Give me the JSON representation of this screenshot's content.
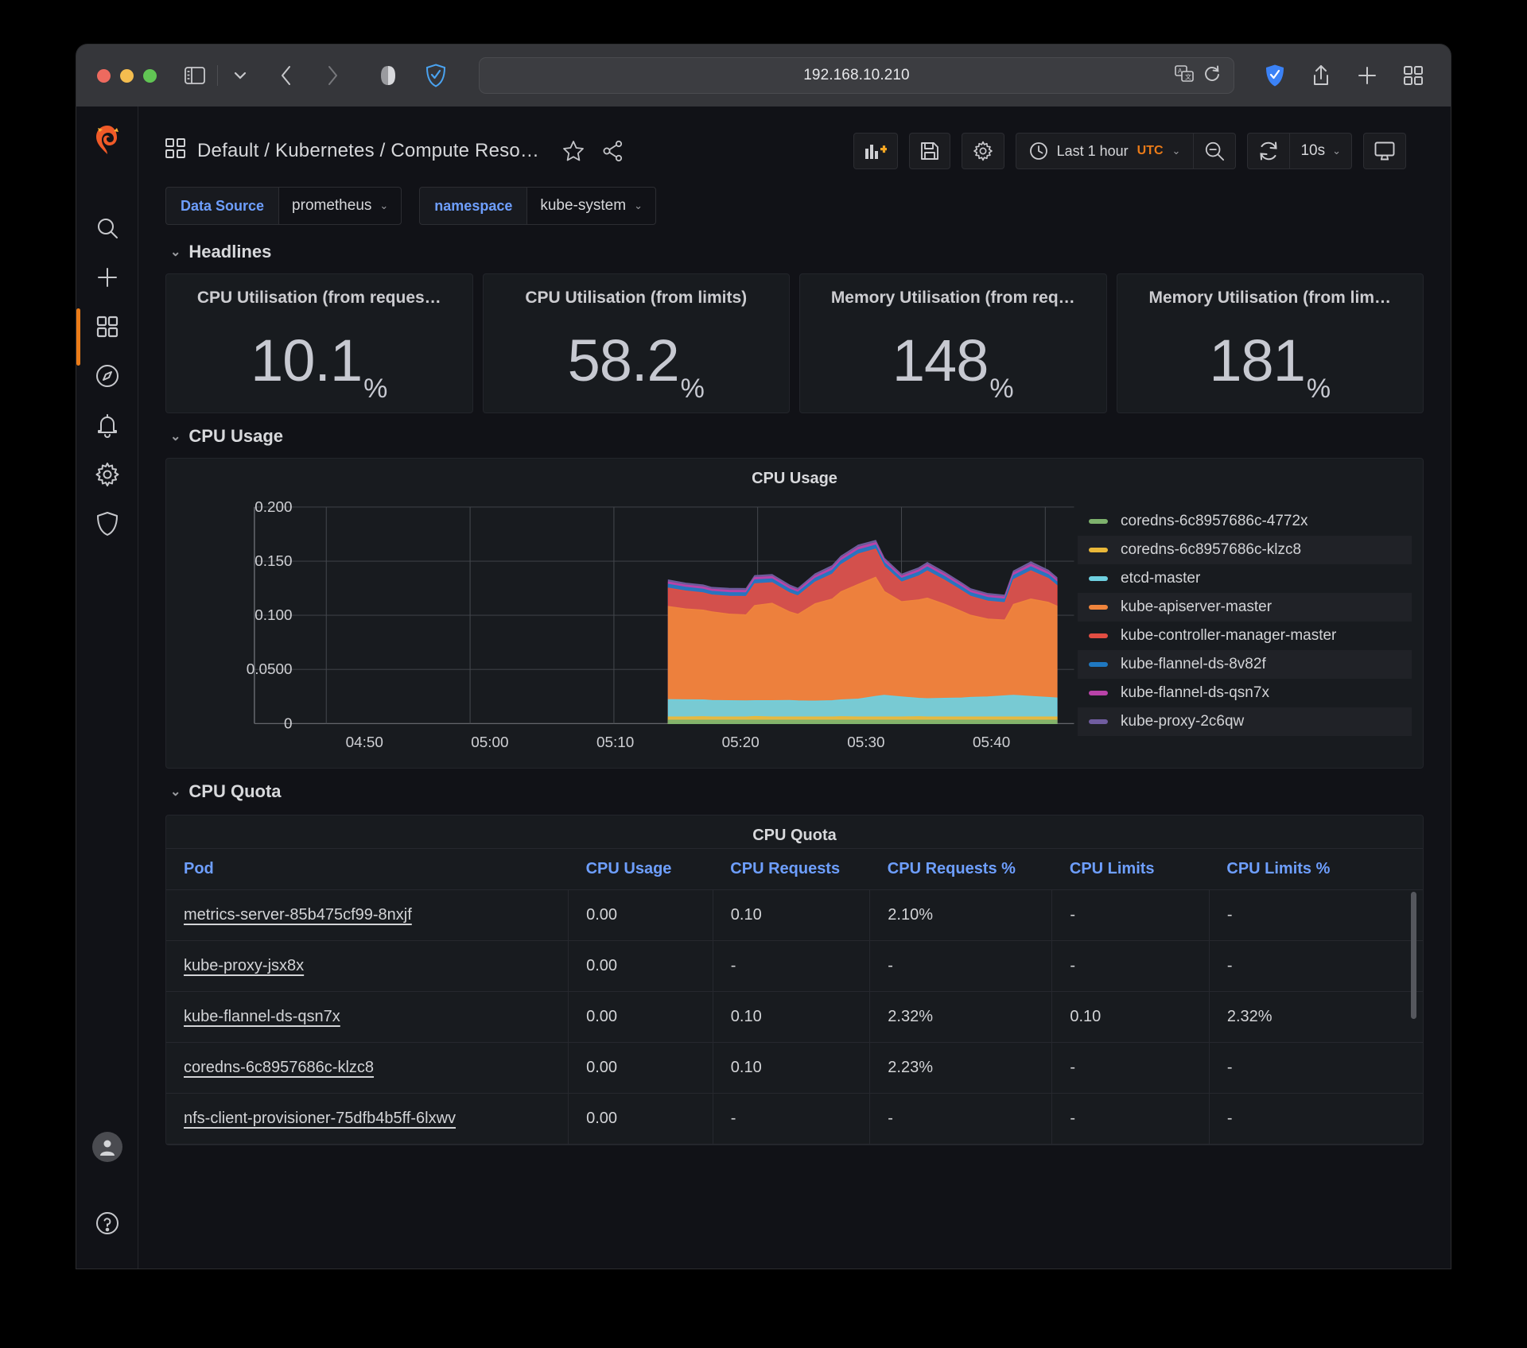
{
  "browser": {
    "url": "192.168.10.210",
    "icons": {
      "sidebar_toggle": "sidebar-toggle-icon",
      "tab_overview": "chevron-down-icon",
      "back": "back-arrow-icon",
      "forward": "forward-arrow-icon",
      "reader": "reader-view-icon",
      "shield": "privacy-shield-icon",
      "translate": "translate-icon",
      "reload": "reload-icon",
      "extension": "extension-icon",
      "share": "share-icon",
      "new_tab": "plus-icon",
      "tab_grid": "tab-overview-grid-icon"
    }
  },
  "sidebar": {
    "logo": "grafana-logo",
    "items": [
      {
        "name": "search",
        "icon": "search-icon",
        "active": false
      },
      {
        "name": "create",
        "icon": "plus-icon",
        "active": false
      },
      {
        "name": "dashboards",
        "icon": "dashboards-grid-icon",
        "active": true
      },
      {
        "name": "explore",
        "icon": "compass-icon",
        "active": false
      },
      {
        "name": "alerting",
        "icon": "bell-icon",
        "active": false
      },
      {
        "name": "configuration",
        "icon": "gear-icon",
        "active": false
      },
      {
        "name": "server-admin",
        "icon": "shield-icon",
        "active": false
      }
    ],
    "profile_icon": "user-avatar-icon",
    "help_icon": "help-circle-icon"
  },
  "header": {
    "dashboard_icon": "dashboard-grid-icon",
    "breadcrumb": "Default  /  Kubernetes  /  Compute Reso…",
    "star_icon": "star-icon",
    "share_icon": "share-nodes-icon",
    "tools": {
      "add_panel": "add-panel-icon",
      "save": "save-icon",
      "settings": "gear-icon",
      "time_range": "Last 1 hour",
      "timezone": "UTC",
      "zoom_out_icon": "zoom-out-icon",
      "refresh_icon": "refresh-icon",
      "refresh_interval": "10s",
      "tv_mode_icon": "tv-mode-icon"
    }
  },
  "variables": [
    {
      "label": "Data Source",
      "value": "prometheus"
    },
    {
      "label": "namespace",
      "value": "kube-system"
    }
  ],
  "rows": {
    "headlines": "Headlines",
    "cpu_usage": "CPU Usage",
    "cpu_quota": "CPU Quota"
  },
  "stats": [
    {
      "title": "CPU Utilisation (from reques…",
      "value": "10.1",
      "unit": "%"
    },
    {
      "title": "CPU Utilisation (from limits)",
      "value": "58.2",
      "unit": "%"
    },
    {
      "title": "Memory Utilisation (from req…",
      "value": "148",
      "unit": "%"
    },
    {
      "title": "Memory Utilisation (from lim…",
      "value": "181",
      "unit": "%"
    }
  ],
  "chart_data": {
    "type": "area",
    "title": "CPU Usage",
    "xlabel": "",
    "ylabel": "",
    "ylim": [
      0,
      0.2
    ],
    "yticks": [
      "0",
      "0.0500",
      "0.100",
      "0.150",
      "0.200"
    ],
    "ytick_values": [
      0,
      0.05,
      0.1,
      0.15,
      0.2
    ],
    "xticks": [
      "04:50",
      "05:00",
      "05:10",
      "05:20",
      "05:30",
      "05:40"
    ],
    "grid": true,
    "legend_position": "right",
    "stacked": true,
    "x": [
      5.23,
      5.25,
      5.27,
      5.28,
      5.3,
      5.32,
      5.33,
      5.35,
      5.37,
      5.38,
      5.4,
      5.42,
      5.43,
      5.45,
      5.47,
      5.48,
      5.5,
      5.52,
      5.53,
      5.55,
      5.57,
      5.58,
      5.6,
      5.62,
      5.63,
      5.65,
      5.67,
      5.68
    ],
    "series": [
      {
        "name": "coredns-6c8957686c-4772x",
        "color": "#7eb26d",
        "values": [
          0.003,
          0.003,
          0.003,
          0.003,
          0.003,
          0.003,
          0.003,
          0.003,
          0.003,
          0.003,
          0.003,
          0.003,
          0.003,
          0.003,
          0.003,
          0.003,
          0.003,
          0.003,
          0.003,
          0.003,
          0.003,
          0.003,
          0.003,
          0.003,
          0.003,
          0.003,
          0.003,
          0.003
        ]
      },
      {
        "name": "coredns-6c8957686c-klzc8",
        "color": "#eab839",
        "values": [
          0.003,
          0.003,
          0.0032,
          0.003,
          0.003,
          0.003,
          0.0034,
          0.003,
          0.003,
          0.003,
          0.003,
          0.003,
          0.0032,
          0.003,
          0.003,
          0.003,
          0.003,
          0.0032,
          0.003,
          0.003,
          0.003,
          0.003,
          0.003,
          0.003,
          0.003,
          0.003,
          0.003,
          0.003
        ]
      },
      {
        "name": "etcd-master",
        "color": "#6ed0e0",
        "values": [
          0.016,
          0.0158,
          0.0155,
          0.0152,
          0.015,
          0.0148,
          0.0146,
          0.015,
          0.0152,
          0.0148,
          0.0146,
          0.015,
          0.0155,
          0.0165,
          0.019,
          0.02,
          0.0185,
          0.017,
          0.0168,
          0.0172,
          0.0175,
          0.018,
          0.0185,
          0.0195,
          0.02,
          0.019,
          0.018,
          0.0175
        ]
      },
      {
        "name": "kube-apiserver-master",
        "color": "#ef843c",
        "values": [
          0.086,
          0.084,
          0.083,
          0.082,
          0.08,
          0.0795,
          0.088,
          0.09,
          0.082,
          0.08,
          0.09,
          0.094,
          0.1,
          0.106,
          0.11,
          0.096,
          0.088,
          0.091,
          0.093,
          0.087,
          0.08,
          0.076,
          0.072,
          0.07,
          0.084,
          0.09,
          0.088,
          0.085
        ]
      },
      {
        "name": "kube-controller-manager-master",
        "color": "#e24d42",
        "values": [
          0.017,
          0.0165,
          0.016,
          0.0155,
          0.0165,
          0.017,
          0.02,
          0.019,
          0.0175,
          0.017,
          0.02,
          0.023,
          0.025,
          0.028,
          0.026,
          0.023,
          0.018,
          0.022,
          0.025,
          0.022,
          0.019,
          0.0175,
          0.0165,
          0.016,
          0.023,
          0.026,
          0.022,
          0.019
        ]
      },
      {
        "name": "kube-flannel-ds-8v82f",
        "color": "#1f78c1",
        "values": [
          0.0035,
          0.0034,
          0.0033,
          0.0033,
          0.0034,
          0.0034,
          0.0035,
          0.0035,
          0.0034,
          0.0033,
          0.0035,
          0.0036,
          0.0036,
          0.0038,
          0.0037,
          0.0036,
          0.0034,
          0.0035,
          0.0036,
          0.0035,
          0.0034,
          0.0033,
          0.0033,
          0.0033,
          0.0036,
          0.0037,
          0.0035,
          0.0034
        ]
      },
      {
        "name": "kube-flannel-ds-qsn7x",
        "color": "#ba43a9",
        "values": [
          0.0022,
          0.0021,
          0.0021,
          0.002,
          0.0021,
          0.0021,
          0.0022,
          0.0022,
          0.0021,
          0.002,
          0.0022,
          0.0023,
          0.0023,
          0.0024,
          0.0023,
          0.0022,
          0.0021,
          0.0022,
          0.0023,
          0.0022,
          0.0021,
          0.002,
          0.002,
          0.002,
          0.0023,
          0.0024,
          0.0022,
          0.0021
        ]
      },
      {
        "name": "kube-proxy-2c6qw",
        "color": "#705da0",
        "values": [
          0.0018,
          0.0018,
          0.0018,
          0.0017,
          0.0018,
          0.0018,
          0.0019,
          0.0019,
          0.0018,
          0.0017,
          0.0019,
          0.002,
          0.002,
          0.0021,
          0.002,
          0.0019,
          0.0018,
          0.0019,
          0.002,
          0.0019,
          0.0018,
          0.0017,
          0.0017,
          0.0017,
          0.002,
          0.0021,
          0.0019,
          0.0018
        ]
      }
    ]
  },
  "table": {
    "title": "CPU Quota",
    "columns": [
      "Pod",
      "CPU Usage",
      "CPU Requests",
      "CPU Requests %",
      "CPU Limits",
      "CPU Limits %"
    ],
    "rows": [
      {
        "pod": "metrics-server-85b475cf99-8nxjf",
        "usage": "0.00",
        "requests": "0.10",
        "requests_pct": "2.10%",
        "limits": "-",
        "limits_pct": "-"
      },
      {
        "pod": "kube-proxy-jsx8x",
        "usage": "0.00",
        "requests": "-",
        "requests_pct": "-",
        "limits": "-",
        "limits_pct": "-"
      },
      {
        "pod": "kube-flannel-ds-qsn7x",
        "usage": "0.00",
        "requests": "0.10",
        "requests_pct": "2.32%",
        "limits": "0.10",
        "limits_pct": "2.32%"
      },
      {
        "pod": "coredns-6c8957686c-klzc8",
        "usage": "0.00",
        "requests": "0.10",
        "requests_pct": "2.23%",
        "limits": "-",
        "limits_pct": "-"
      },
      {
        "pod": "nfs-client-provisioner-75dfb4b5ff-6lxwv",
        "usage": "0.00",
        "requests": "-",
        "requests_pct": "-",
        "limits": "-",
        "limits_pct": "-"
      }
    ]
  }
}
